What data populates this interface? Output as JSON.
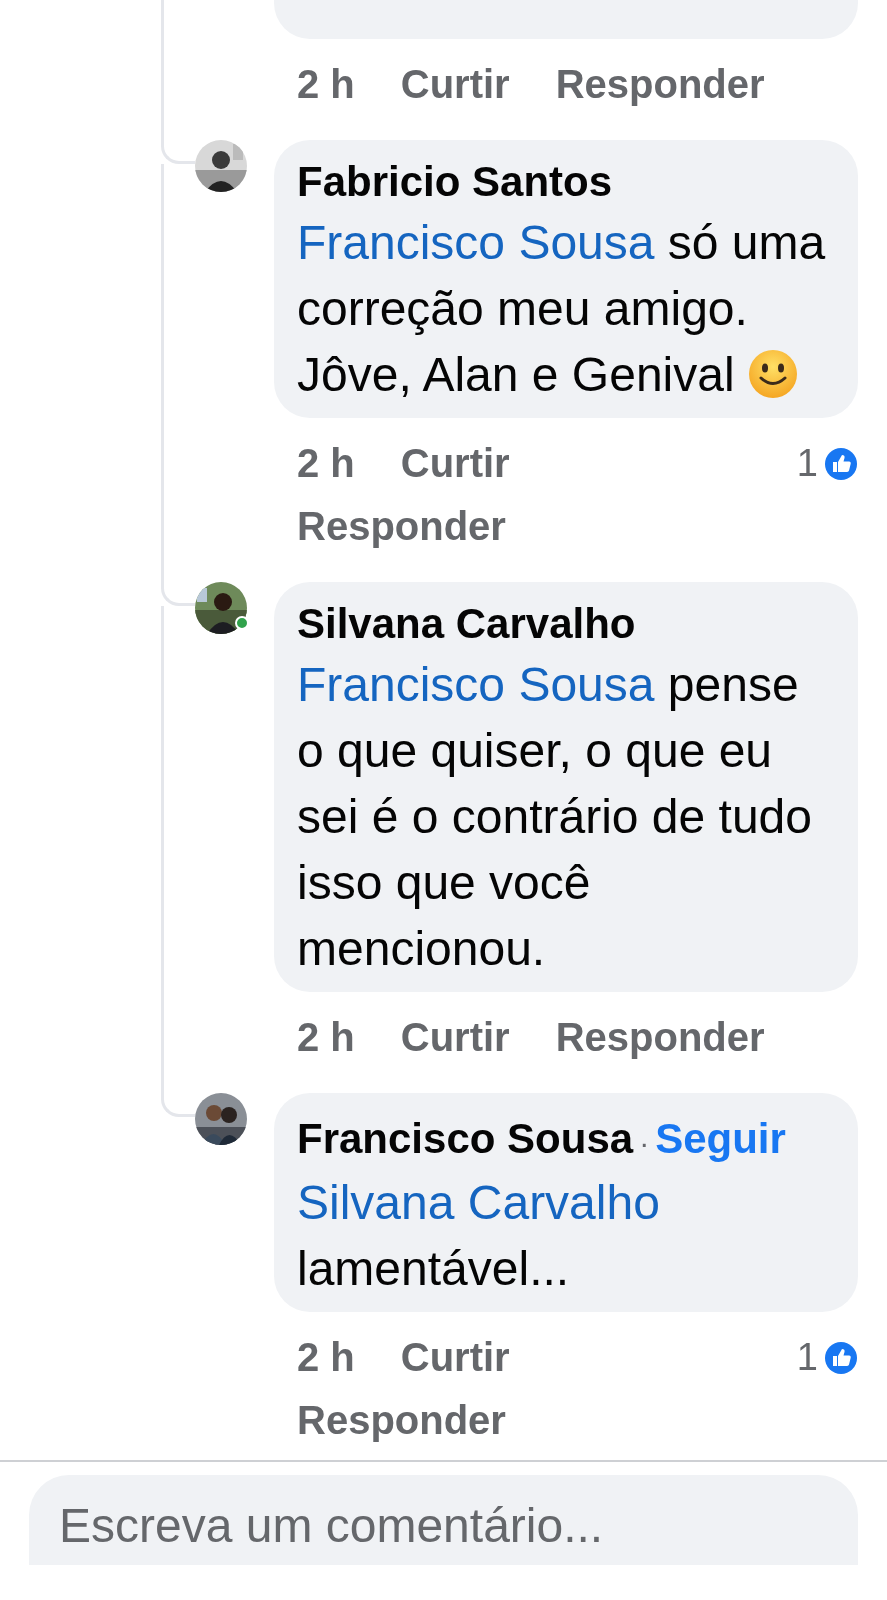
{
  "previous_comment": {
    "time": "2 h",
    "like": "Curtir",
    "reply": "Responder"
  },
  "comments": [
    {
      "author": "Fabricio Santos",
      "online": false,
      "segments": [
        {
          "kind": "mention",
          "text": "Francisco Sousa"
        },
        {
          "kind": "text",
          "text": " só uma correção meu amigo. Jôve, Alan e Genival "
        },
        {
          "kind": "emoji"
        }
      ],
      "time": "2 h",
      "like": "Curtir",
      "reply": "Responder",
      "reactions": "1"
    },
    {
      "author": "Silvana Carvalho",
      "online": true,
      "segments": [
        {
          "kind": "mention",
          "text": "Francisco Sousa"
        },
        {
          "kind": "text",
          "text": " pense o que quiser, o que eu sei é o contrário de tudo isso que você mencionou."
        }
      ],
      "time": "2 h",
      "like": "Curtir",
      "reply": "Responder"
    },
    {
      "author": "Francisco Sousa",
      "online": false,
      "separator": "·",
      "follow": "Seguir",
      "segments": [
        {
          "kind": "mention",
          "text": "Silvana Carvalho"
        },
        {
          "kind": "text",
          "text": " lamentável..."
        }
      ],
      "time": "2 h",
      "like": "Curtir",
      "reply": "Responder",
      "reactions": "1"
    }
  ],
  "composer": {
    "placeholder": "Escreva um comentário..."
  }
}
